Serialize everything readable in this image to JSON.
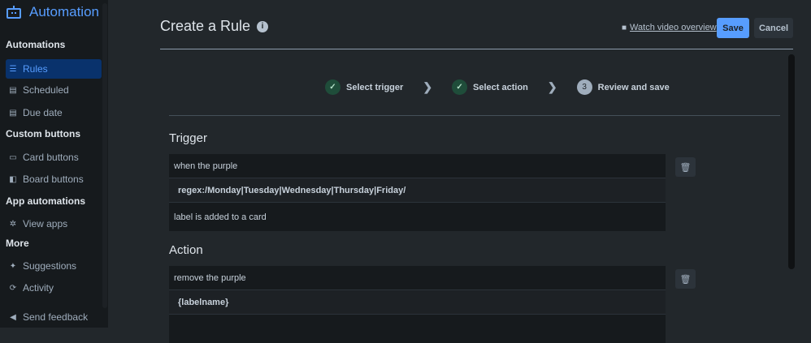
{
  "sidebar": {
    "brand": "Automation",
    "sections": [
      {
        "title": "Automations"
      },
      {
        "title": "Custom buttons"
      },
      {
        "title": "App automations"
      },
      {
        "title": "More"
      }
    ],
    "items": [
      {
        "label": "Rules",
        "icon": "sliders-icon"
      },
      {
        "label": "Scheduled",
        "icon": "calendar-icon"
      },
      {
        "label": "Due date",
        "icon": "calendar-icon"
      },
      {
        "label": "Card buttons",
        "icon": "card-icon"
      },
      {
        "label": "Board buttons",
        "icon": "board-icon"
      },
      {
        "label": "View apps",
        "icon": "gear-icon"
      },
      {
        "label": "Suggestions",
        "icon": "sparkle-icon"
      },
      {
        "label": "Activity",
        "icon": "refresh-icon"
      },
      {
        "label": "Send feedback",
        "icon": "megaphone-icon"
      }
    ]
  },
  "header": {
    "title": "Create a Rule",
    "video_link": "Watch video overview",
    "save": "Save",
    "cancel": "Cancel"
  },
  "steps": [
    {
      "label": "Select trigger",
      "state": "done"
    },
    {
      "label": "Select action",
      "state": "done"
    },
    {
      "label": "Review and save",
      "number": "3",
      "state": "current"
    }
  ],
  "trigger": {
    "heading": "Trigger",
    "line1": "when the purple",
    "input": "regex:/Monday|Tuesday|Wednesday|Thursday|Friday/",
    "line2": "label is added to a card"
  },
  "action": {
    "heading": "Action",
    "line1": "remove the purple",
    "input": "{labelname}"
  },
  "colors": {
    "accent": "#579dff",
    "active_bg": "#09326c",
    "done_step": "#1f4d3a"
  }
}
